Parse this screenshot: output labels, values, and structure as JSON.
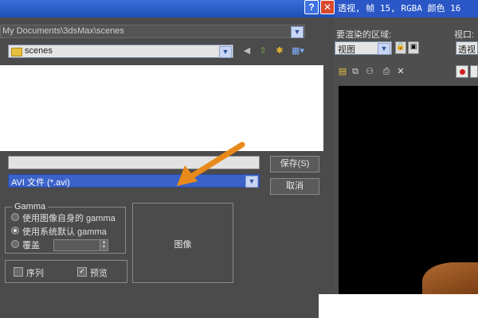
{
  "dialog": {
    "help_glyph": "?",
    "close_glyph": "✕",
    "path": "My Documents\\3dsMax\\scenes",
    "folder": "scenes",
    "filename": "",
    "file_type": "AVI 文件 (*.avi)",
    "save_label": "保存(S)",
    "cancel_label": "取消",
    "gamma": {
      "legend": "Gamma",
      "options": [
        "使用图像自身的 gamma",
        "使用系统默认 gamma",
        "覆盖"
      ],
      "selected_index": 1,
      "override_value": ""
    },
    "image_label": "图像",
    "sequence_label": "序列",
    "sequence_checked": false,
    "preview_label": "预览",
    "preview_checked": true,
    "arrow_color": "#e88a1a"
  },
  "viewport": {
    "title": "透视, 帧 15, RGBA 颜色 16",
    "area_label": "要渲染的区域:",
    "area_value": "视图",
    "viewport_label": "视口:",
    "viewport_value": "透视"
  },
  "colors": {
    "titlebar": "#2a56c6",
    "dialog_bg": "#4b4b4b",
    "selection": "#3a62c9",
    "render_bg": "#000000",
    "object": "#b06a30"
  }
}
